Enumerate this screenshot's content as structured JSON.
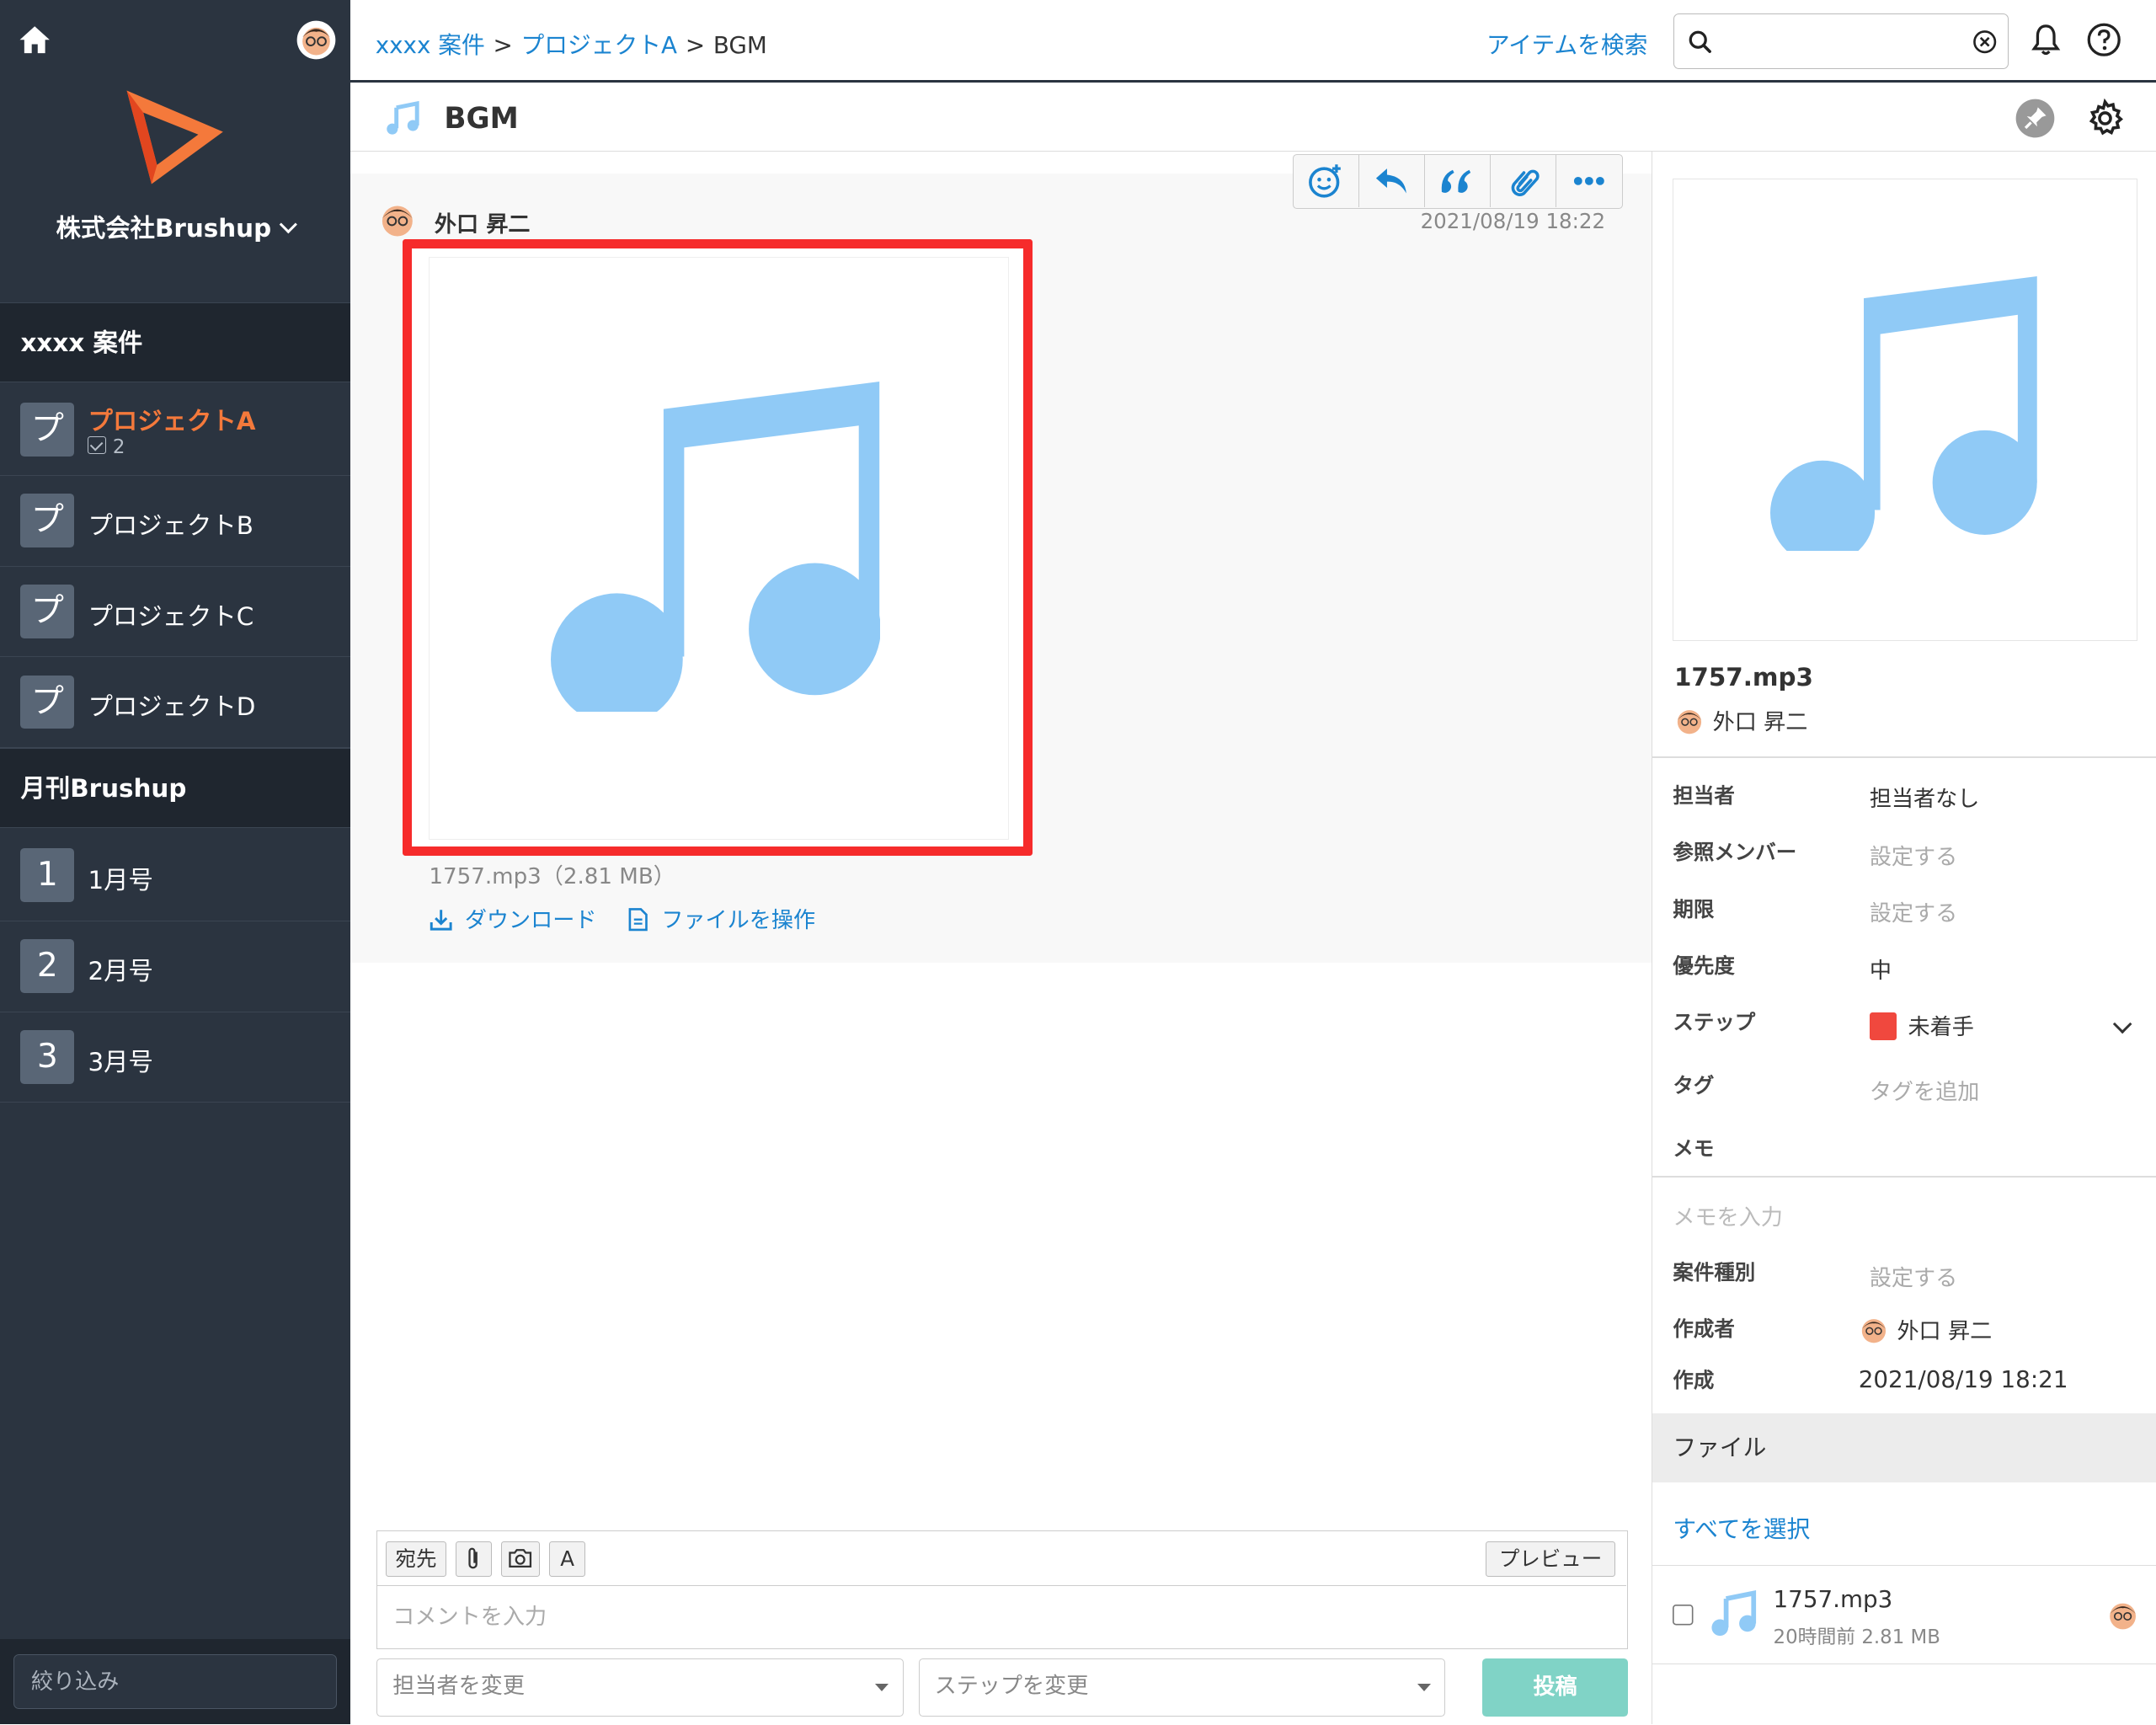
{
  "sidebar": {
    "company_name": "株式会社Brushup",
    "sections": [
      {
        "title": "xxxx 案件",
        "items": [
          {
            "badge": "プ",
            "label": "プロジェクトA",
            "sub_count": "2",
            "active": true
          },
          {
            "badge": "プ",
            "label": "プロジェクトB"
          },
          {
            "badge": "プ",
            "label": "プロジェクトC"
          },
          {
            "badge": "プ",
            "label": "プロジェクトD"
          }
        ]
      },
      {
        "title": "月刊Brushup",
        "items": [
          {
            "badge": "1",
            "label": "1月号"
          },
          {
            "badge": "2",
            "label": "2月号"
          },
          {
            "badge": "3",
            "label": "3月号"
          }
        ]
      }
    ],
    "filter_placeholder": "絞り込み"
  },
  "topbar": {
    "breadcrumb": {
      "root": "xxxx 案件",
      "project": "プロジェクトA",
      "separator": ">",
      "current": "BGM"
    },
    "search_link": "アイテムを検索",
    "search_value": ""
  },
  "title": {
    "text": "BGM"
  },
  "post": {
    "author": "外口 昇二",
    "date": "2021/08/19 18:22",
    "file_caption": "1757.mp3（2.81 MB）",
    "download_label": "ダウンロード",
    "operate_label": "ファイルを操作"
  },
  "composer": {
    "to_label": "宛先",
    "text_label": "A",
    "preview_label": "プレビュー",
    "comment_placeholder": "コメントを入力",
    "assignee_select": "担当者を変更",
    "step_select": "ステップを変更",
    "post_label": "投稿"
  },
  "rpanel": {
    "file_name": "1757.mp3",
    "owner": "外口 昇二",
    "props": {
      "assignee": {
        "label": "担当者",
        "value": "担当者なし"
      },
      "members": {
        "label": "参照メンバー",
        "value": "設定する"
      },
      "due": {
        "label": "期限",
        "value": "設定する"
      },
      "priority": {
        "label": "優先度",
        "value": "中"
      },
      "step": {
        "label": "ステップ",
        "value": "未着手",
        "color": "#f0483e"
      },
      "tags": {
        "label": "タグ",
        "value": "タグを追加"
      },
      "memo": {
        "label": "メモ",
        "placeholder": "メモを入力"
      },
      "category": {
        "label": "案件種別",
        "value": "設定する"
      },
      "creator": {
        "label": "作成者",
        "value": "外口 昇二"
      },
      "created": {
        "label": "作成",
        "value": "2021/08/19 18:21"
      }
    },
    "files_header": "ファイル",
    "select_all": "すべてを選択",
    "file": {
      "name": "1757.mp3",
      "meta": "20時間前 2.81 MB"
    }
  },
  "colors": {
    "accent": "#1b84d0",
    "note": "#90caf6",
    "highlight": "#f62b2b",
    "active_project": "#f4793b"
  }
}
